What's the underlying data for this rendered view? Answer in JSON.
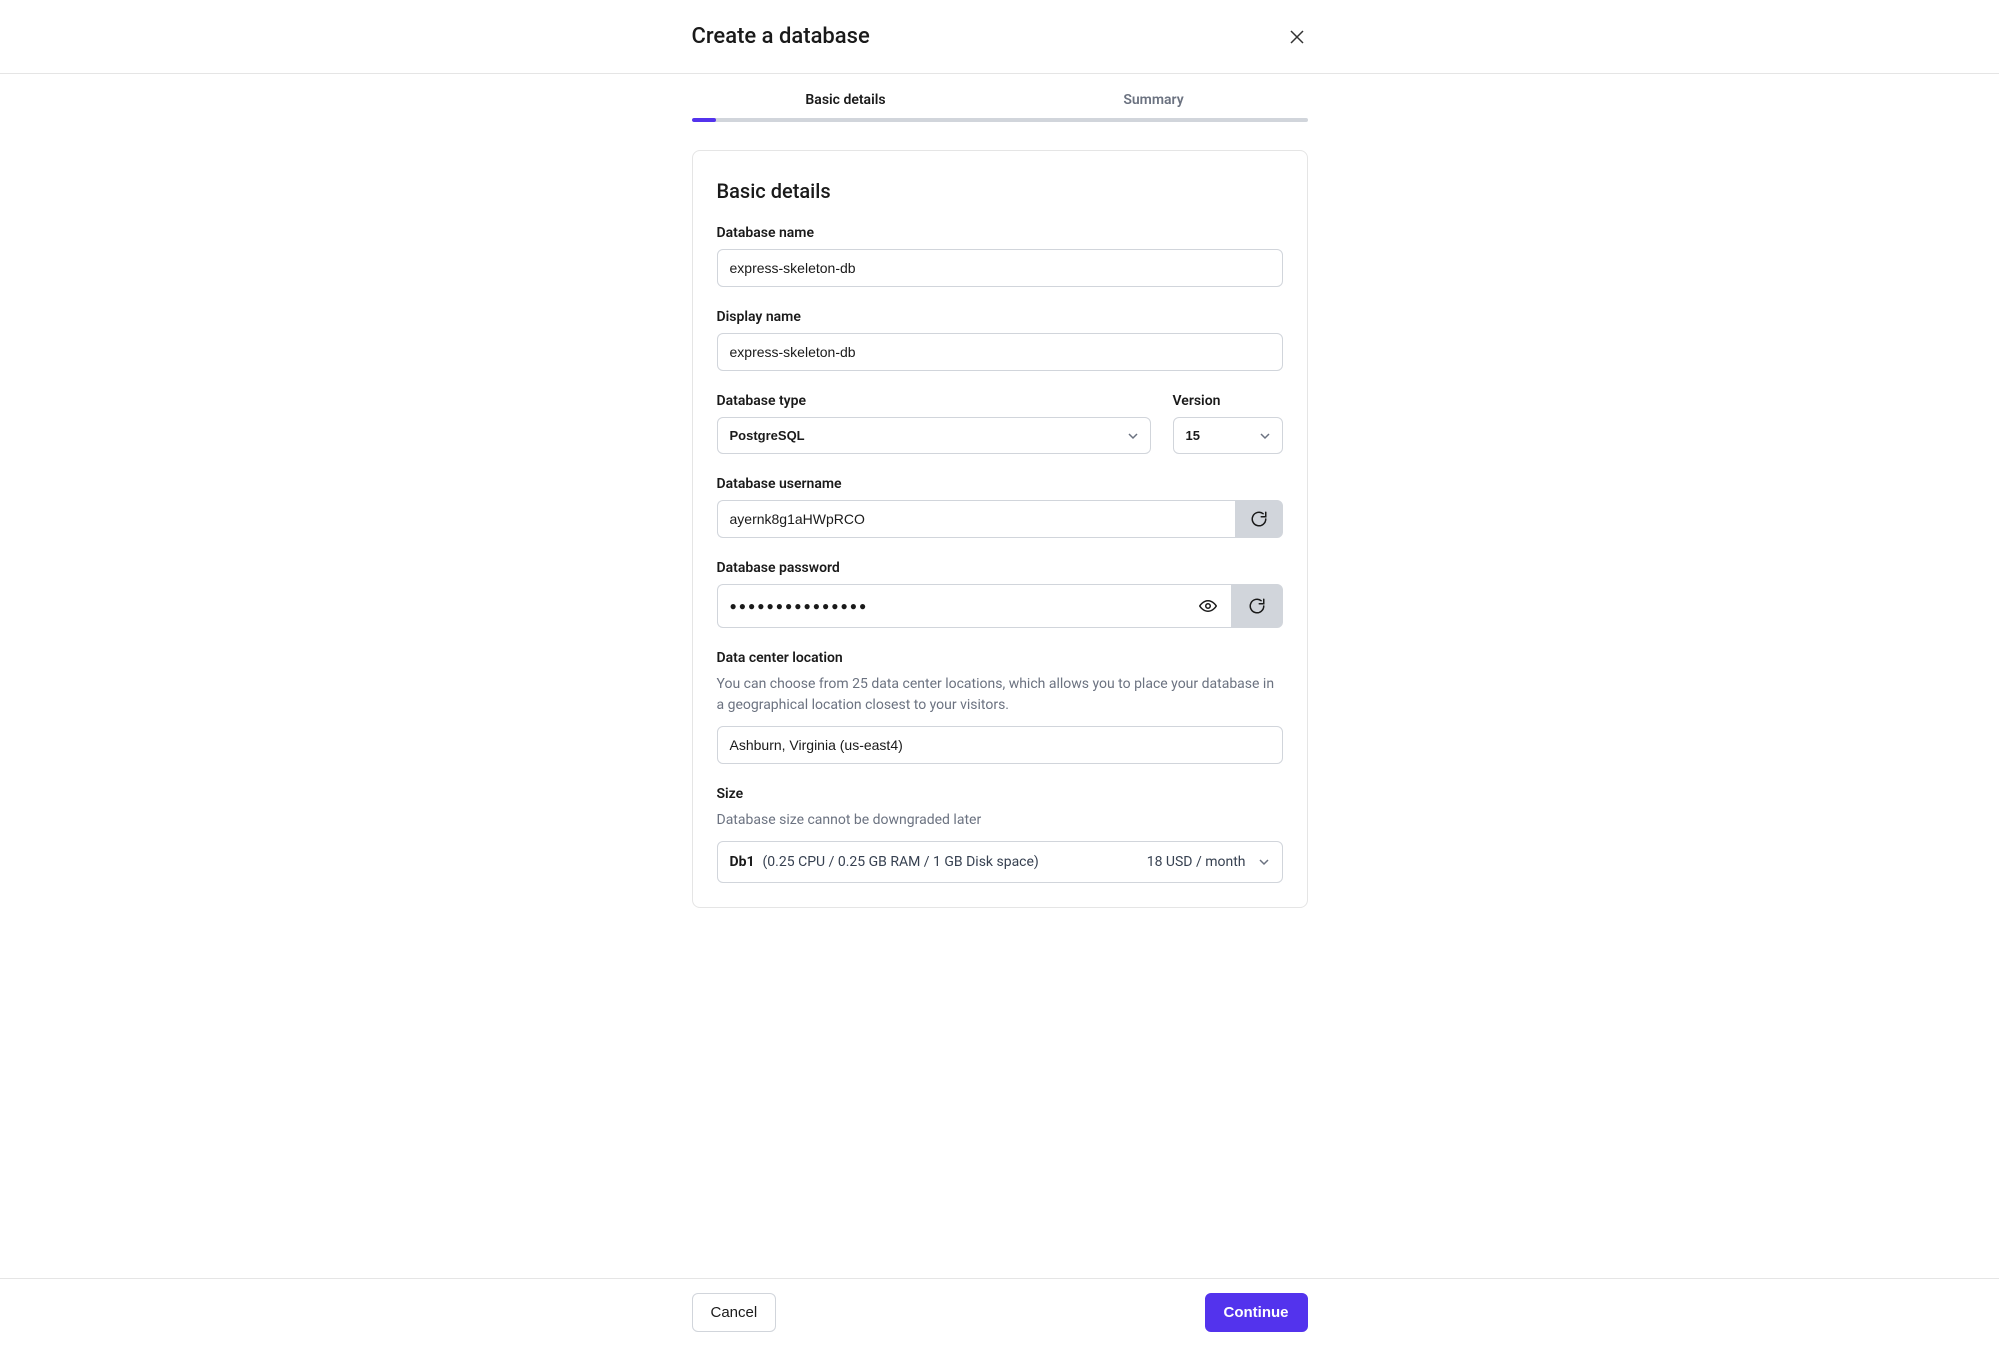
{
  "header": {
    "title": "Create a database"
  },
  "stepper": {
    "step1": "Basic details",
    "step2": "Summary"
  },
  "section": {
    "title": "Basic details"
  },
  "fields": {
    "dbname": {
      "label": "Database name",
      "value": "express-skeleton-db"
    },
    "display": {
      "label": "Display name",
      "value": "express-skeleton-db"
    },
    "dbtype": {
      "label": "Database type",
      "value": "PostgreSQL"
    },
    "version": {
      "label": "Version",
      "value": "15"
    },
    "username": {
      "label": "Database username",
      "value": "ayernk8g1aHWpRCO"
    },
    "password": {
      "label": "Database password",
      "masked": "●●●●●●●●●●●●●●●"
    },
    "location": {
      "label": "Data center location",
      "help": "You can choose from 25 data center locations, which allows you to place your database in a geographical location closest to your visitors.",
      "value": "Ashburn, Virginia (us-east4)"
    },
    "size": {
      "label": "Size",
      "help": "Database size cannot be downgraded later",
      "name": "Db1",
      "spec": "(0.25 CPU / 0.25 GB RAM / 1 GB Disk space)",
      "price": "18 USD / month"
    }
  },
  "footer": {
    "cancel": "Cancel",
    "continue": "Continue"
  }
}
